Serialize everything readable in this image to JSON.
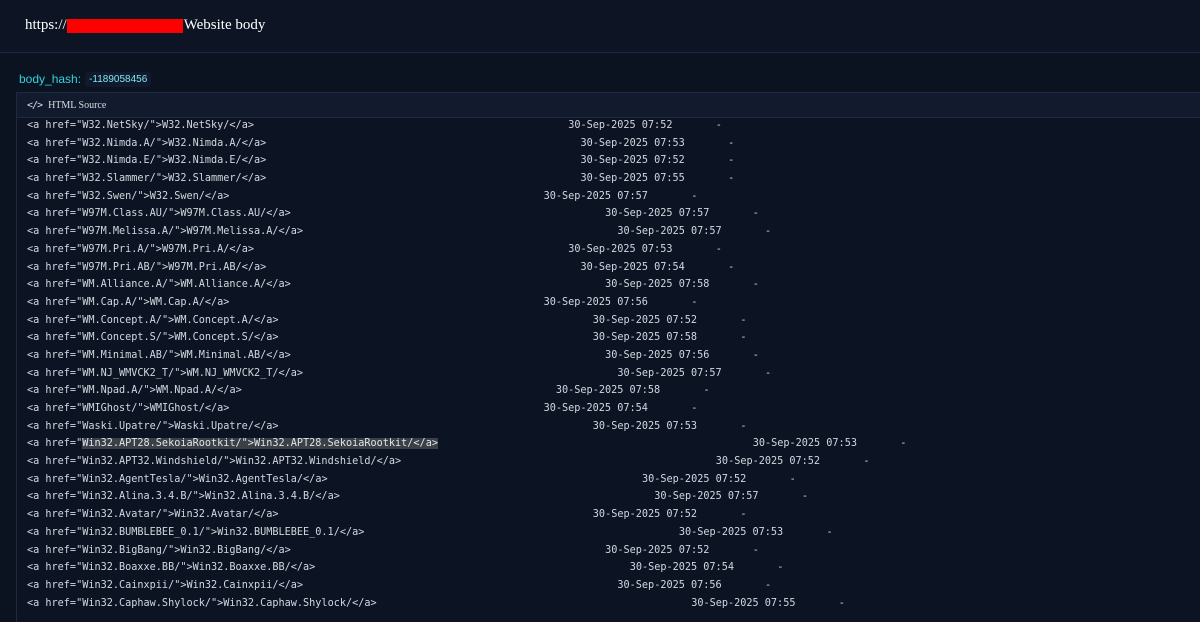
{
  "header": {
    "prefix": "https://",
    "suffix": "Website body"
  },
  "body_hash": {
    "label": "body_hash:",
    "value": "-1189058456"
  },
  "panel": {
    "icon": "code-icon",
    "title": "HTML Source"
  },
  "highlight_color": "#3a3f48",
  "lines": [
    {
      "name": "W32.NetSky/",
      "date": "30-Sep-2025 07:52",
      "size": "-"
    },
    {
      "name": "W32.Nimda.A/",
      "date": "30-Sep-2025 07:53",
      "size": "-"
    },
    {
      "name": "W32.Nimda.E/",
      "date": "30-Sep-2025 07:52",
      "size": "-"
    },
    {
      "name": "W32.Slammer/",
      "date": "30-Sep-2025 07:55",
      "size": "-"
    },
    {
      "name": "W32.Swen/",
      "date": "30-Sep-2025 07:57",
      "size": "-"
    },
    {
      "name": "W97M.Class.AU/",
      "date": "30-Sep-2025 07:57",
      "size": "-"
    },
    {
      "name": "W97M.Melissa.A/",
      "date": "30-Sep-2025 07:57",
      "size": "-"
    },
    {
      "name": "W97M.Pri.A/",
      "date": "30-Sep-2025 07:53",
      "size": "-"
    },
    {
      "name": "W97M.Pri.AB/",
      "date": "30-Sep-2025 07:54",
      "size": "-"
    },
    {
      "name": "WM.Alliance.A/",
      "date": "30-Sep-2025 07:58",
      "size": "-"
    },
    {
      "name": "WM.Cap.A/",
      "date": "30-Sep-2025 07:56",
      "size": "-"
    },
    {
      "name": "WM.Concept.A/",
      "date": "30-Sep-2025 07:52",
      "size": "-"
    },
    {
      "name": "WM.Concept.S/",
      "date": "30-Sep-2025 07:58",
      "size": "-"
    },
    {
      "name": "WM.Minimal.AB/",
      "date": "30-Sep-2025 07:56",
      "size": "-"
    },
    {
      "name": "WM.NJ_WMVCK2_T/",
      "date": "30-Sep-2025 07:57",
      "size": "-"
    },
    {
      "name": "WM.Npad.A/",
      "date": "30-Sep-2025 07:58",
      "size": "-"
    },
    {
      "name": "WMIGhost/",
      "date": "30-Sep-2025 07:54",
      "size": "-"
    },
    {
      "name": "Waski.Upatre/",
      "date": "30-Sep-2025 07:53",
      "size": "-"
    },
    {
      "name": "Win32.APT28.SekoiaRootkit/",
      "date": "30-Sep-2025 07:53",
      "size": "-",
      "highlighted": true
    },
    {
      "name": "Win32.APT32.Windshield/",
      "date": "30-Sep-2025 07:52",
      "size": "-"
    },
    {
      "name": "Win32.AgentTesla/",
      "date": "30-Sep-2025 07:52",
      "size": "-"
    },
    {
      "name": "Win32.Alina.3.4.B/",
      "date": "30-Sep-2025 07:57",
      "size": "-"
    },
    {
      "name": "Win32.Avatar/",
      "date": "30-Sep-2025 07:52",
      "size": "-"
    },
    {
      "name": "Win32.BUMBLEBEE_0.1/",
      "date": "30-Sep-2025 07:53",
      "size": "-"
    },
    {
      "name": "Win32.BigBang/",
      "date": "30-Sep-2025 07:52",
      "size": "-"
    },
    {
      "name": "Win32.Boaxxe.BB/",
      "date": "30-Sep-2025 07:54",
      "size": "-"
    },
    {
      "name": "Win32.Cainxpii/",
      "date": "30-Sep-2025 07:56",
      "size": "-"
    },
    {
      "name": "Win32.Caphaw.Shylock/",
      "date": "30-Sep-2025 07:55",
      "size": "-"
    }
  ]
}
